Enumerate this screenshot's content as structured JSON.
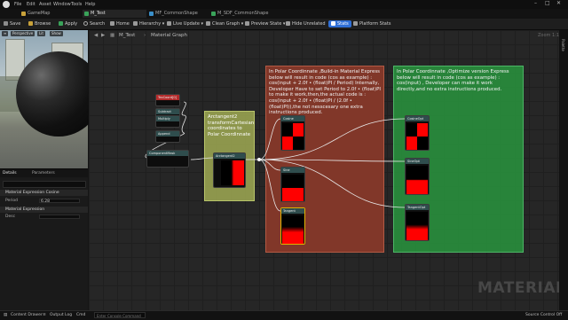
{
  "menu": [
    "File",
    "Edit",
    "Asset",
    "Window",
    "Tools",
    "Help"
  ],
  "tabs": [
    {
      "label": "GameMap",
      "color": "#c9a23a"
    },
    {
      "label": "M_Test",
      "color": "#3aa35a"
    },
    {
      "label": "MF_CommonShape",
      "color": "#3a8fc9"
    },
    {
      "label": "M_SDF_CommonShape",
      "color": "#3aa35a"
    }
  ],
  "toolbar": {
    "save": "Save",
    "browse": "Browse",
    "apply": "Apply",
    "search": "Search",
    "home": "Home",
    "hierarchy": "Hierarchy",
    "live_update": "Live Update",
    "clean_graph": "Clean Graph",
    "preview_state": "Preview State",
    "hide_unrelated": "Hide Unrelated",
    "stats": "Stats",
    "platform_stats": "Platform Stats"
  },
  "viewport": {
    "perspective": "Perspective",
    "lit": "Lit",
    "show": "Show"
  },
  "details": {
    "tab_details": "Details",
    "tab_parameters": "Parameters",
    "section1": "Material Expression Cosine",
    "prop_period": "Period",
    "val_period": "6.28",
    "section2": "Material Expression",
    "prop_desc": "Desc"
  },
  "graph": {
    "breadcrumb": "M_Test",
    "breadcrumb2": "Material Graph",
    "zoom": "Zoom 1:1"
  },
  "comments": {
    "yellow": "Arctangent2 transformCartesian coordinates to Polar Coordinnate",
    "red": "In Polar Coordinnate ,Build-in Material Express below will result in code (cos as example) : cos(input + 2.0f • (float)PI / Period) Internally, Developer Have to set  Period to 2.0f • (float)PI to make it work,then,the actual code is : cos(input + 2.0f • (float)PI / (2.0f • (float)PI)),the  not nesscesary one extra instructions produced.",
    "green": "In Polar Coordinnate ,Optimize version Express below will result in code (cos as example) : cos(input) , Developer can make it work directly,and no extra instructions produced."
  },
  "nodes": {
    "texcoord": "TexCoord[0]",
    "subtract": "Subtract",
    "multiply": "Multiply",
    "append": "Append",
    "component_mask": "ComponentMask",
    "atan2": "Arctangent2",
    "cos1": "Cosine",
    "sin1": "Sine",
    "tan1": "Tangent",
    "cos2": "CosineOpt",
    "sin2": "SineOpt",
    "tan2": "TangentOpt"
  },
  "watermark": "MATERIAL",
  "bottombar": {
    "content_drawer": "Content Drawer",
    "output_log": "Output Log",
    "cmd": "Cmd",
    "cmd_placeholder": "Enter Console Command",
    "source_control": "Source Control Off"
  }
}
